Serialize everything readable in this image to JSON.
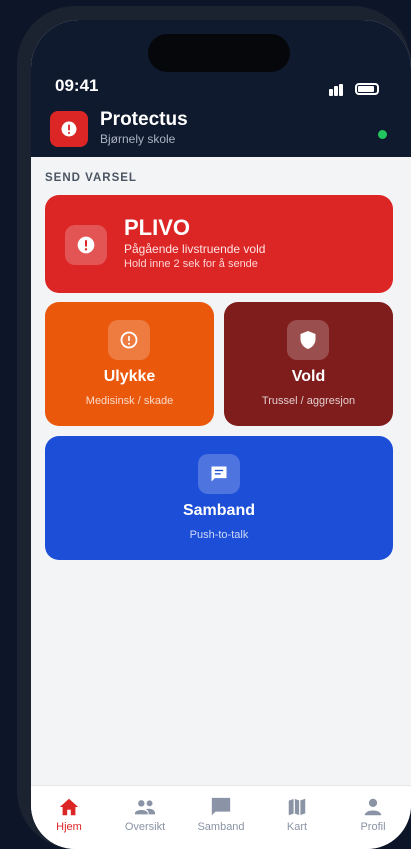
{
  "status_bar": {
    "time": "09:41"
  },
  "app": {
    "title": "Protectus",
    "subtitle": "Bjørnely skole",
    "online_color": "#22c55e"
  },
  "section": {
    "label": "SEND VARSEL"
  },
  "alerts": {
    "plivo": {
      "title": "PLIVO",
      "line1": "Pågående livstruende vold",
      "line2": "Hold inne 2 sek for å sende",
      "color": "#dc2626",
      "icon": "alert-circle-icon"
    },
    "ulykke": {
      "title": "Ulykke",
      "subtitle": "Medisinsk / skade",
      "color": "#ea580c",
      "icon": "warning-circle-icon"
    },
    "vold": {
      "title": "Vold",
      "subtitle": "Trussel / aggresjon",
      "color": "#7f1d1d",
      "icon": "shield-icon"
    },
    "samband": {
      "title": "Samband",
      "subtitle": "Push-to-talk",
      "color": "#1d4ed8",
      "icon": "chat-icon"
    }
  },
  "tabs": [
    {
      "label": "Hjem",
      "icon": "home-icon",
      "active": true
    },
    {
      "label": "Oversikt",
      "icon": "people-icon",
      "active": false
    },
    {
      "label": "Samband",
      "icon": "chat-icon",
      "active": false
    },
    {
      "label": "Kart",
      "icon": "map-icon",
      "active": false
    },
    {
      "label": "Profil",
      "icon": "person-icon",
      "active": false
    }
  ]
}
